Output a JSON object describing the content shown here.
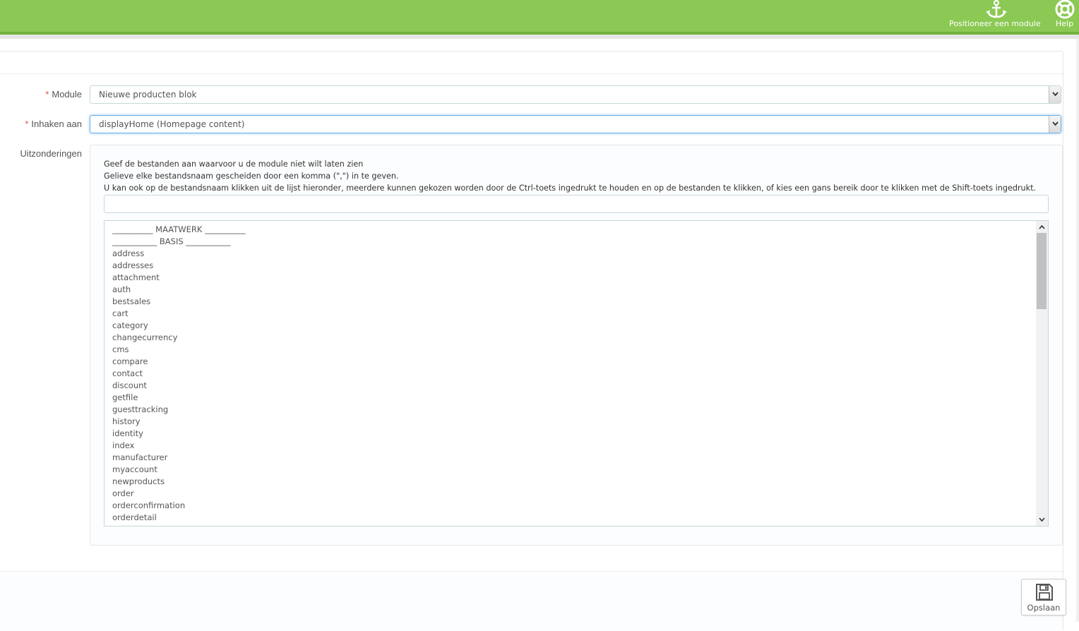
{
  "toolbar": {
    "position_module_label": "Positioneer een module",
    "help_label": "Help",
    "position_icon": "anchor-icon",
    "help_icon": "lifebuoy-icon"
  },
  "form": {
    "module_label": "Module",
    "module_value": "Nieuwe producten blok",
    "hook_label": "Inhaken aan",
    "hook_value": "displayHome (Homepage content)",
    "required_marker": "*",
    "exceptions_label": "Uitzonderingen",
    "help_lines": [
      "Geef de bestanden aan waarvoor u de module niet wilt laten zien",
      "Gelieve elke bestandsnaam gescheiden door een komma (\",\") in te geven.",
      "U kan ook op de bestandsnaam klikken uit de lijst hieronder, meerdere kunnen gekozen worden door de Ctrl-toets ingedrukt te houden en op de bestanden te klikken, of kies een gans bereik door te klikken met de Shift-toets ingedrukt."
    ],
    "exceptions_input_value": "",
    "file_list": [
      "__________ MAATWERK __________",
      "___________ BASIS ___________",
      "address",
      "addresses",
      "attachment",
      "auth",
      "bestsales",
      "cart",
      "category",
      "changecurrency",
      "cms",
      "compare",
      "contact",
      "discount",
      "getfile",
      "guesttracking",
      "history",
      "identity",
      "index",
      "manufacturer",
      "myaccount",
      "newproducts",
      "order",
      "orderconfirmation",
      "orderdetail"
    ]
  },
  "footer": {
    "save_label": "Opslaan",
    "save_icon": "floppy-disk-icon"
  },
  "colors": {
    "header_green": "#8bc954",
    "header_border": "#72b23c",
    "required_red": "#d9534f",
    "focus_blue": "#66afe9"
  }
}
